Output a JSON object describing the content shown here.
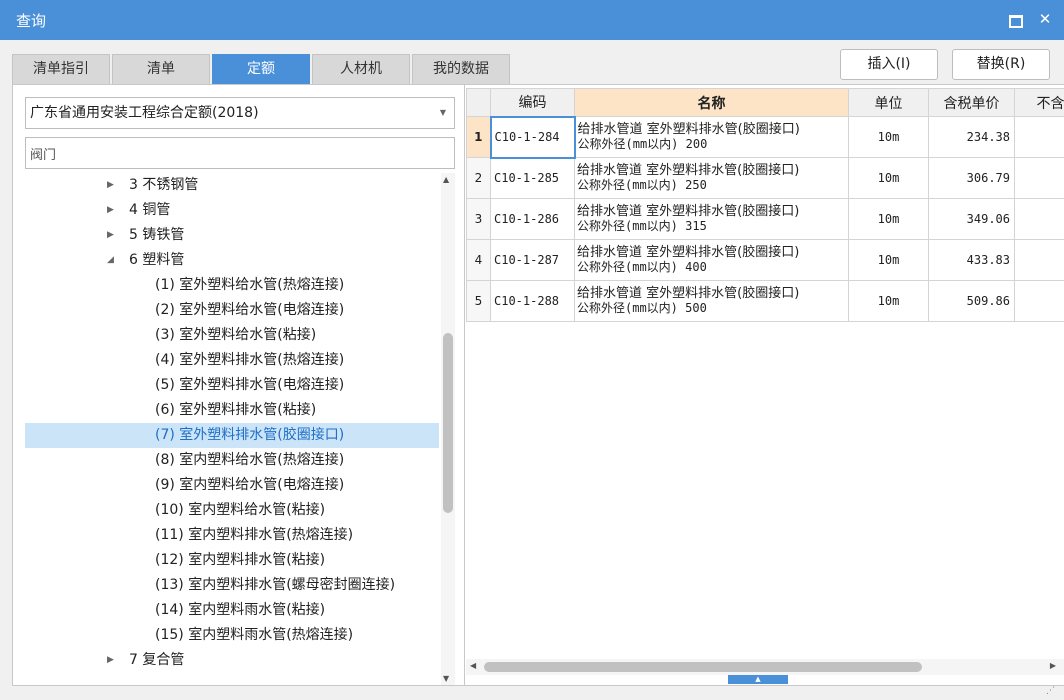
{
  "window": {
    "title": "查询",
    "maximize_icon": "maximize-icon",
    "close_symbol": "✕"
  },
  "tabs": [
    {
      "label": "清单指引",
      "active": false
    },
    {
      "label": "清单",
      "active": false
    },
    {
      "label": "定额",
      "active": true
    },
    {
      "label": "人材机",
      "active": false
    },
    {
      "label": "我的数据",
      "active": false
    }
  ],
  "buttons": {
    "insert": "插入(I)",
    "replace": "替换(R)"
  },
  "left": {
    "library": "广东省通用安装工程综合定额(2018)",
    "search_value": "阀门",
    "tree": [
      {
        "toggle": "▶",
        "label": "3 不锈钢管",
        "level": 1
      },
      {
        "toggle": "▶",
        "label": "4 铜管",
        "level": 1
      },
      {
        "toggle": "▶",
        "label": "5 铸铁管",
        "level": 1
      },
      {
        "toggle": "◢",
        "label": "6 塑料管",
        "level": 1
      },
      {
        "label": "(1) 室外塑料给水管(热熔连接)",
        "level": 2
      },
      {
        "label": "(2) 室外塑料给水管(电熔连接)",
        "level": 2
      },
      {
        "label": "(3) 室外塑料给水管(粘接)",
        "level": 2
      },
      {
        "label": "(4) 室外塑料排水管(热熔连接)",
        "level": 2
      },
      {
        "label": "(5) 室外塑料排水管(电熔连接)",
        "level": 2
      },
      {
        "label": "(6) 室外塑料排水管(粘接)",
        "level": 2
      },
      {
        "label": "(7) 室外塑料排水管(胶圈接口)",
        "level": 2,
        "selected": true
      },
      {
        "label": "(8) 室内塑料给水管(热熔连接)",
        "level": 2
      },
      {
        "label": "(9) 室内塑料给水管(电熔连接)",
        "level": 2
      },
      {
        "label": "(10) 室内塑料给水管(粘接)",
        "level": 2
      },
      {
        "label": "(11) 室内塑料排水管(热熔连接)",
        "level": 2
      },
      {
        "label": "(12) 室内塑料排水管(粘接)",
        "level": 2
      },
      {
        "label": "(13) 室内塑料排水管(螺母密封圈连接)",
        "level": 2
      },
      {
        "label": "(14) 室内塑料雨水管(粘接)",
        "level": 2
      },
      {
        "label": "(15) 室内塑料雨水管(热熔连接)",
        "level": 2
      },
      {
        "toggle": "▶",
        "label": "7 复合管",
        "level": 1
      }
    ]
  },
  "grid": {
    "columns": [
      "",
      "编码",
      "名称",
      "单位",
      "含税单价",
      "不含"
    ],
    "rows": [
      {
        "num": "1",
        "code": "C10-1-284",
        "name1": "给排水管道 室外塑料排水管(胶圈接口)",
        "name2": "公称外径(mm以内) 200",
        "unit": "10m",
        "price": "234.38",
        "active": true
      },
      {
        "num": "2",
        "code": "C10-1-285",
        "name1": "给排水管道 室外塑料排水管(胶圈接口)",
        "name2": "公称外径(mm以内) 250",
        "unit": "10m",
        "price": "306.79"
      },
      {
        "num": "3",
        "code": "C10-1-286",
        "name1": "给排水管道 室外塑料排水管(胶圈接口)",
        "name2": "公称外径(mm以内) 315",
        "unit": "10m",
        "price": "349.06"
      },
      {
        "num": "4",
        "code": "C10-1-287",
        "name1": "给排水管道 室外塑料排水管(胶圈接口)",
        "name2": "公称外径(mm以内) 400",
        "unit": "10m",
        "price": "433.83"
      },
      {
        "num": "5",
        "code": "C10-1-288",
        "name1": "给排水管道 室外塑料排水管(胶圈接口)",
        "name2": "公称外径(mm以内) 500",
        "unit": "10m",
        "price": "509.86"
      }
    ]
  },
  "colors": {
    "accent": "#4a90d9",
    "header_highlight": "#fde4c6",
    "selection": "#cce4f7"
  }
}
